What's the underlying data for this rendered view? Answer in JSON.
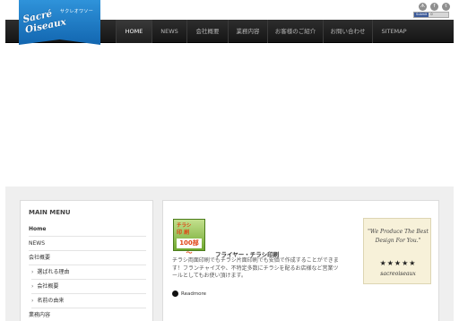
{
  "logo": {
    "subtitle": "サクレオワソー",
    "title": "Sacré Oiseaux"
  },
  "social": [
    {
      "icon": "rss-icon",
      "glyph": "ᗑ"
    },
    {
      "icon": "facebook-icon",
      "glyph": "f"
    },
    {
      "icon": "twitter-icon",
      "glyph": "t"
    }
  ],
  "badge": {
    "left": "Submit",
    "right": "0"
  },
  "nav": {
    "items": [
      {
        "label": "HOME",
        "active": true
      },
      {
        "label": "NEWS"
      },
      {
        "label": "会社概要"
      },
      {
        "label": "業務内容"
      },
      {
        "label": "お客様のご紹介"
      },
      {
        "label": "お問い合わせ"
      },
      {
        "label": "SITEMAP"
      }
    ]
  },
  "sidebar": {
    "title": "MAIN MENU",
    "items": [
      {
        "label": "Home"
      },
      {
        "label": "NEWS"
      },
      {
        "label": "会社概要"
      },
      {
        "label": "選ばれる理由"
      },
      {
        "label": "会社概要"
      },
      {
        "label": "名前の由来"
      },
      {
        "label": "業務内容"
      }
    ]
  },
  "post": {
    "thumb_line1": "チラシ",
    "thumb_line2": "印 刷",
    "thumb_line3": "100部～",
    "title": "フライヤー・チラシ印刷",
    "excerpt": "チラシ両面印刷でもチラシ片面印刷でも安価で作成することができます！フランチャイズや、不特定多数にチラシを配るお店様など営業ツールとしてもお使い頂けます。",
    "readmore": "Readmore"
  },
  "quote": {
    "text": "\"We Produce The Best Design For You.\"",
    "stars": "★★★★★",
    "rating": 5,
    "author": "sacreoiseaux"
  }
}
